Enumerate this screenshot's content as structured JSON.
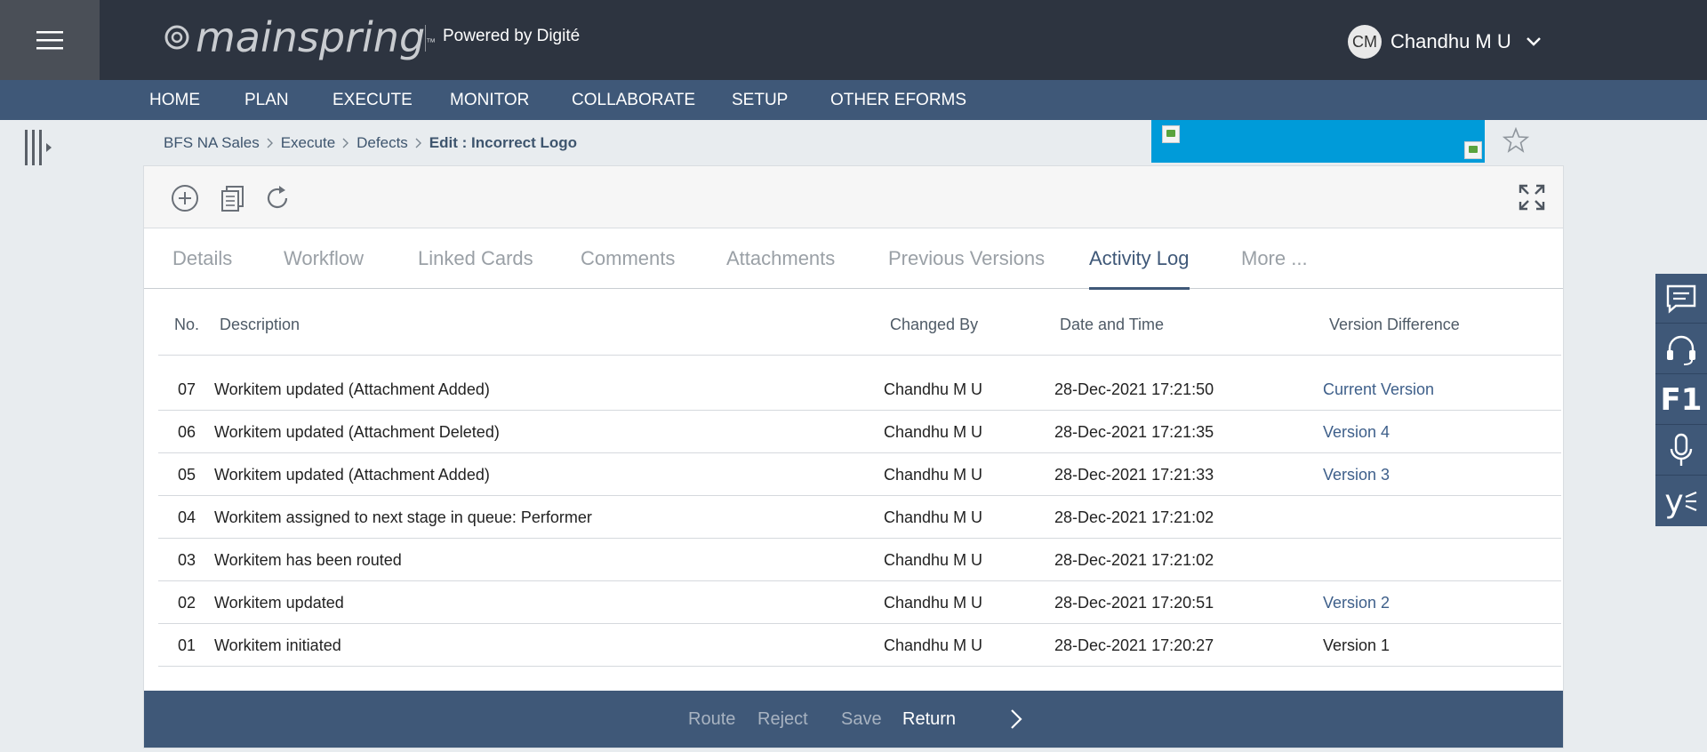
{
  "header": {
    "logo_text": "mainspring",
    "logo_tm": "™",
    "powered_by": "Powered by Digité",
    "user_initials": "CM",
    "user_name": "Chandhu M U"
  },
  "nav": {
    "items": [
      "HOME",
      "PLAN",
      "EXECUTE",
      "MONITOR",
      "COLLABORATE",
      "SETUP",
      "OTHER EFORMS"
    ]
  },
  "breadcrumb": {
    "items": [
      "BFS NA Sales",
      "Execute",
      "Defects"
    ],
    "current": "Edit : Incorrect Logo"
  },
  "tabs": {
    "items": [
      "Details",
      "Workflow",
      "Linked Cards",
      "Comments",
      "Attachments",
      "Previous Versions",
      "Activity Log",
      "More ..."
    ],
    "active": "Activity Log"
  },
  "table": {
    "headers": [
      "No.",
      "Description",
      "Changed By",
      "Date and Time",
      "Version Difference"
    ],
    "rows": [
      {
        "no": "07",
        "description": "Workitem updated (Attachment Added)",
        "changed_by": "Chandhu M U",
        "datetime": "28-Dec-2021 17:21:50",
        "version": "Current Version"
      },
      {
        "no": "06",
        "description": "Workitem updated (Attachment Deleted)",
        "changed_by": "Chandhu M U",
        "datetime": "28-Dec-2021 17:21:35",
        "version": "Version 4"
      },
      {
        "no": "05",
        "description": "Workitem updated (Attachment Added)",
        "changed_by": "Chandhu M U",
        "datetime": "28-Dec-2021 17:21:33",
        "version": "Version 3"
      },
      {
        "no": "04",
        "description": "Workitem assigned to next stage in queue: Performer",
        "changed_by": "Chandhu M U",
        "datetime": "28-Dec-2021 17:21:02",
        "version": ""
      },
      {
        "no": "03",
        "description": "Workitem has been routed",
        "changed_by": "Chandhu M U",
        "datetime": "28-Dec-2021 17:21:02",
        "version": ""
      },
      {
        "no": "02",
        "description": "Workitem updated",
        "changed_by": "Chandhu M U",
        "datetime": "28-Dec-2021 17:20:51",
        "version": "Version 2"
      },
      {
        "no": "01",
        "description": "Workitem initiated",
        "changed_by": "Chandhu M U",
        "datetime": "28-Dec-2021 17:20:27",
        "version": "Version 1"
      }
    ]
  },
  "footer": {
    "route": "Route",
    "reject": "Reject",
    "save": "Save",
    "return": "Return"
  },
  "rail": {
    "f1_label": "F1",
    "y_label": "y"
  },
  "colors": {
    "header_bg": "#2d3440",
    "nav_bg": "#3f5878",
    "banner": "#009bd9",
    "link": "#3e5f8a"
  }
}
